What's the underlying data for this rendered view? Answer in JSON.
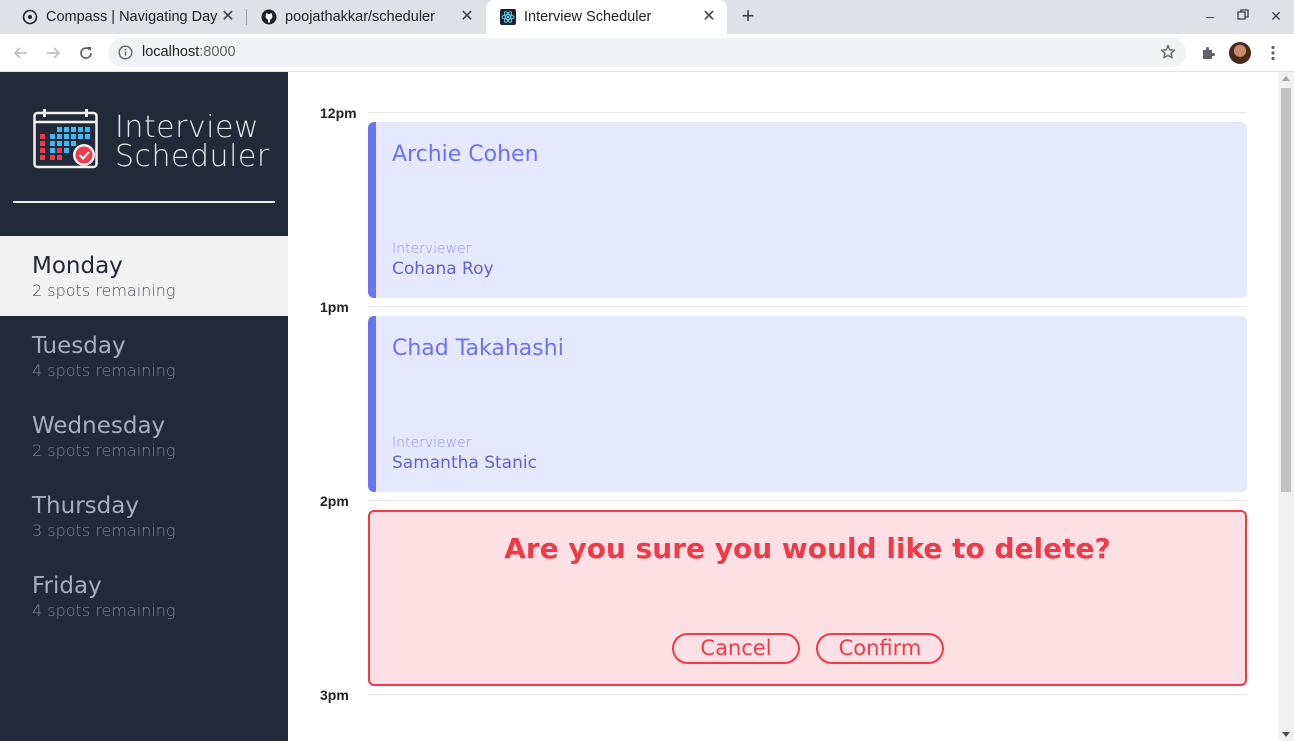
{
  "browser": {
    "tabs": [
      {
        "title": "Compass | Navigating Day",
        "icon": "compass-icon",
        "active": false
      },
      {
        "title": "poojathakkar/scheduler",
        "icon": "github-icon",
        "active": false
      },
      {
        "title": "Interview Scheduler",
        "icon": "react-icon",
        "active": true
      }
    ],
    "url_host": "localhost",
    "url_port": ":8000"
  },
  "app": {
    "brand_line1": "Interview",
    "brand_line2": "Scheduler",
    "days": [
      {
        "name": "Monday",
        "spots": "2 spots remaining",
        "selected": true
      },
      {
        "name": "Tuesday",
        "spots": "4 spots remaining",
        "selected": false
      },
      {
        "name": "Wednesday",
        "spots": "2 spots remaining",
        "selected": false
      },
      {
        "name": "Thursday",
        "spots": "3 spots remaining",
        "selected": false
      },
      {
        "name": "Friday",
        "spots": "4 spots remaining",
        "selected": false
      }
    ],
    "times": [
      "12pm",
      "1pm",
      "2pm",
      "3pm"
    ],
    "appointments": [
      {
        "student": "Archie Cohen",
        "interviewer_label": "Interviewer",
        "interviewer": "Cohana Roy"
      },
      {
        "student": "Chad Takahashi",
        "interviewer_label": "Interviewer",
        "interviewer": "Samantha Stanic"
      }
    ],
    "confirm": {
      "message": "Are you sure you would like to delete?",
      "cancel_label": "Cancel",
      "confirm_label": "Confirm"
    }
  },
  "colors": {
    "sidebar_bg": "#222939",
    "appointment_bg": "#e6e8fe",
    "appointment_accent": "#6c73f0",
    "danger": "#ee3b4b",
    "danger_bg": "#fde0e3"
  }
}
